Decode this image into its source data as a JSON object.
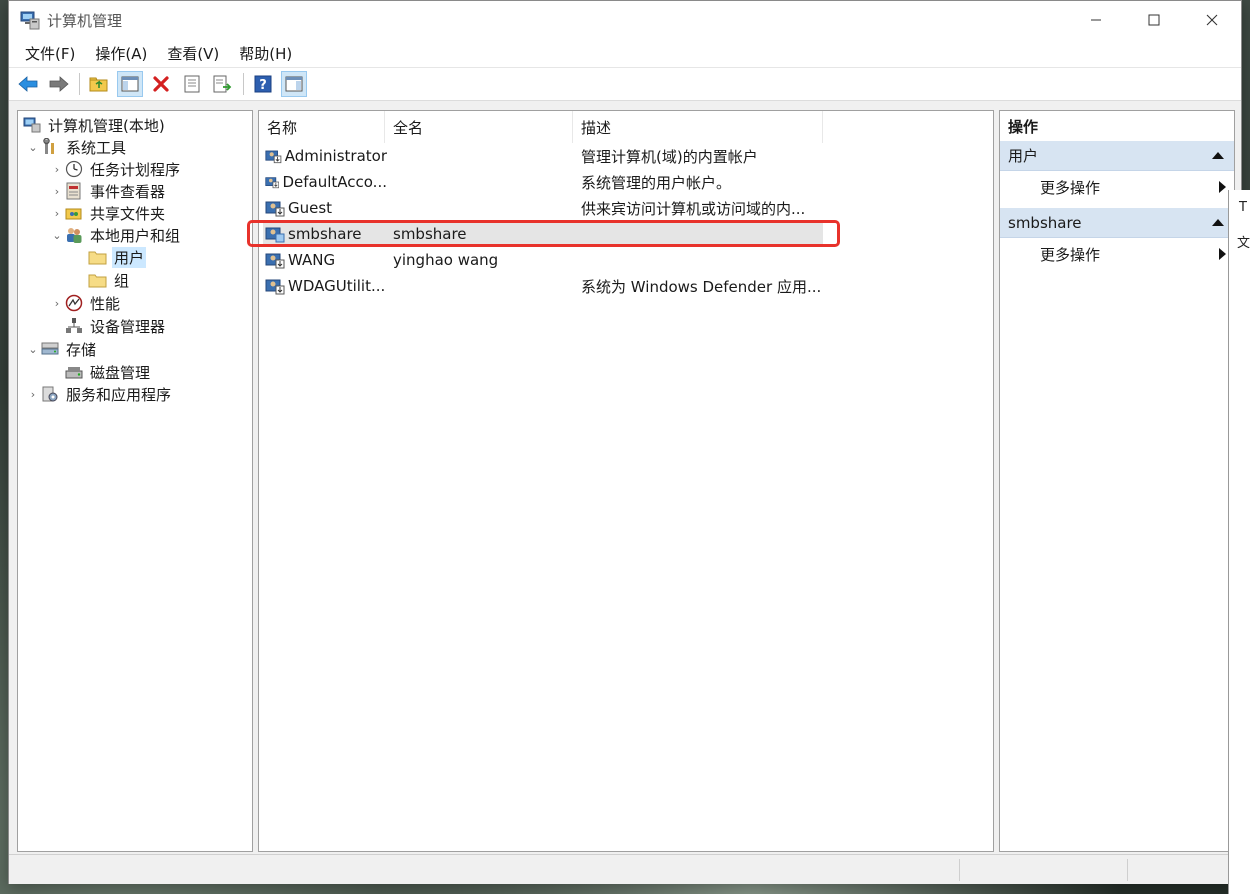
{
  "window": {
    "title": "计算机管理",
    "controls": {
      "minimize": "—",
      "maximize": "☐",
      "close": "✕"
    }
  },
  "menu": [
    {
      "label": "文件(F)"
    },
    {
      "label": "操作(A)"
    },
    {
      "label": "查看(V)"
    },
    {
      "label": "帮助(H)"
    }
  ],
  "toolbar": {
    "icons": [
      "back-arrow-icon",
      "forward-arrow-icon",
      "up-folder-icon",
      "show-hide-tree-icon",
      "delete-icon",
      "properties-icon",
      "export-list-icon",
      "help-icon",
      "show-hide-action-pane-icon"
    ]
  },
  "tree": {
    "root": "计算机管理(本地)",
    "system_tools": "系统工具",
    "task_scheduler": "任务计划程序",
    "event_viewer": "事件查看器",
    "shared_folders": "共享文件夹",
    "local_users_groups": "本地用户和组",
    "users": "用户",
    "groups": "组",
    "performance": "性能",
    "device_manager": "设备管理器",
    "storage": "存储",
    "disk_management": "磁盘管理",
    "services_apps": "服务和应用程序",
    "toggles": {
      "expanded": "⌄",
      "collapsed": "›"
    }
  },
  "list": {
    "columns": {
      "name": "名称",
      "fullname": "全名",
      "description": "描述"
    },
    "rows": [
      {
        "name": "Administrator",
        "fullname": "",
        "description": "管理计算机(域)的内置帐户"
      },
      {
        "name": "DefaultAcco...",
        "fullname": "",
        "description": "系统管理的用户帐户。"
      },
      {
        "name": "Guest",
        "fullname": "",
        "description": "供来宾访问计算机或访问域的内..."
      },
      {
        "name": "smbshare",
        "fullname": "smbshare",
        "description": ""
      },
      {
        "name": "WANG",
        "fullname": "yinghao wang",
        "description": ""
      },
      {
        "name": "WDAGUtilit...",
        "fullname": "",
        "description": "系统为 Windows Defender 应用..."
      }
    ],
    "highlighted_row": "smbshare"
  },
  "actions": {
    "header": "操作",
    "section1": "用户",
    "more1": "更多操作",
    "section2": "smbshare",
    "more2": "更多操作"
  },
  "side_window": {
    "text1": "T",
    "text2": "文"
  },
  "colors": {
    "annotation": "#e8322b",
    "section_bg": "#d7e4f2",
    "selected_bg": "#cce8ff"
  }
}
